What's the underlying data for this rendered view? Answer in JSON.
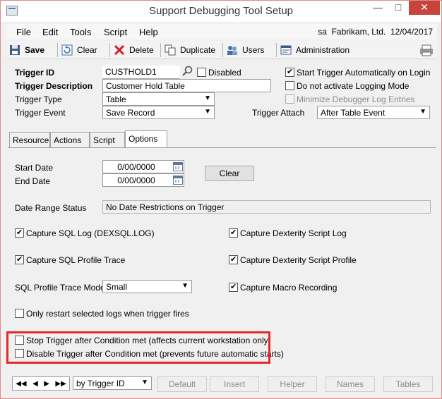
{
  "window": {
    "title": "Support Debugging Tool Setup",
    "close_glyph": "✕",
    "max_glyph": "□",
    "min_glyph": "—"
  },
  "menu": {
    "items": [
      "File",
      "Edit",
      "Tools",
      "Script",
      "Help"
    ],
    "user": "sa",
    "company": "Fabrikam, Ltd.",
    "date": "12/04/2017"
  },
  "toolbar": {
    "save": "Save",
    "clear": "Clear",
    "delete": "Delete",
    "duplicate": "Duplicate",
    "users": "Users",
    "administration": "Administration"
  },
  "header": {
    "trigger_id_label": "Trigger ID",
    "trigger_id_value": "CUSTHOLD1",
    "disabled_label": "Disabled",
    "trigger_description_label": "Trigger Description",
    "trigger_description_value": "Customer Hold Table",
    "trigger_type_label": "Trigger Type",
    "trigger_type_value": "Table",
    "trigger_event_label": "Trigger Event",
    "trigger_event_value": "Save Record",
    "start_auto_label": "Start Trigger Automatically on Login",
    "no_logging_label": "Do not activate Logging Mode",
    "minimize_label": "Minimize Debugger Log Entries",
    "trigger_attach_label": "Trigger Attach",
    "trigger_attach_value": "After Table Event",
    "start_auto_checked": true,
    "no_logging_checked": false,
    "minimize_checked": false
  },
  "tabs": [
    "Resource",
    "Actions",
    "Script",
    "Options"
  ],
  "options": {
    "start_date_label": "Start Date",
    "start_date_value": "0/00/0000",
    "end_date_label": "End Date",
    "end_date_value": "0/00/0000",
    "clear_label": "Clear",
    "date_range_status_label": "Date Range Status",
    "date_range_status_value": "No Date Restrictions on Trigger",
    "capture_sql_log": "Capture SQL Log (DEXSQL.LOG)",
    "capture_sql_profile": "Capture SQL Profile Trace",
    "sql_profile_mode_label": "SQL Profile Trace Mode",
    "sql_profile_mode_value": "Small",
    "capture_dex_script_log": "Capture Dexterity Script Log",
    "capture_dex_script_profile": "Capture Dexterity Script Profile",
    "capture_macro": "Capture Macro Recording",
    "only_restart": "Only restart selected logs when trigger fires",
    "stop_trigger": "Stop Trigger after Condition met (affects current workstation only)",
    "disable_trigger": "Disable Trigger after Condition met (prevents future automatic starts)"
  },
  "bottom": {
    "sort_value": "by Trigger ID",
    "default": "Default",
    "insert": "Insert",
    "helper": "Helper",
    "names": "Names",
    "tables": "Tables"
  }
}
